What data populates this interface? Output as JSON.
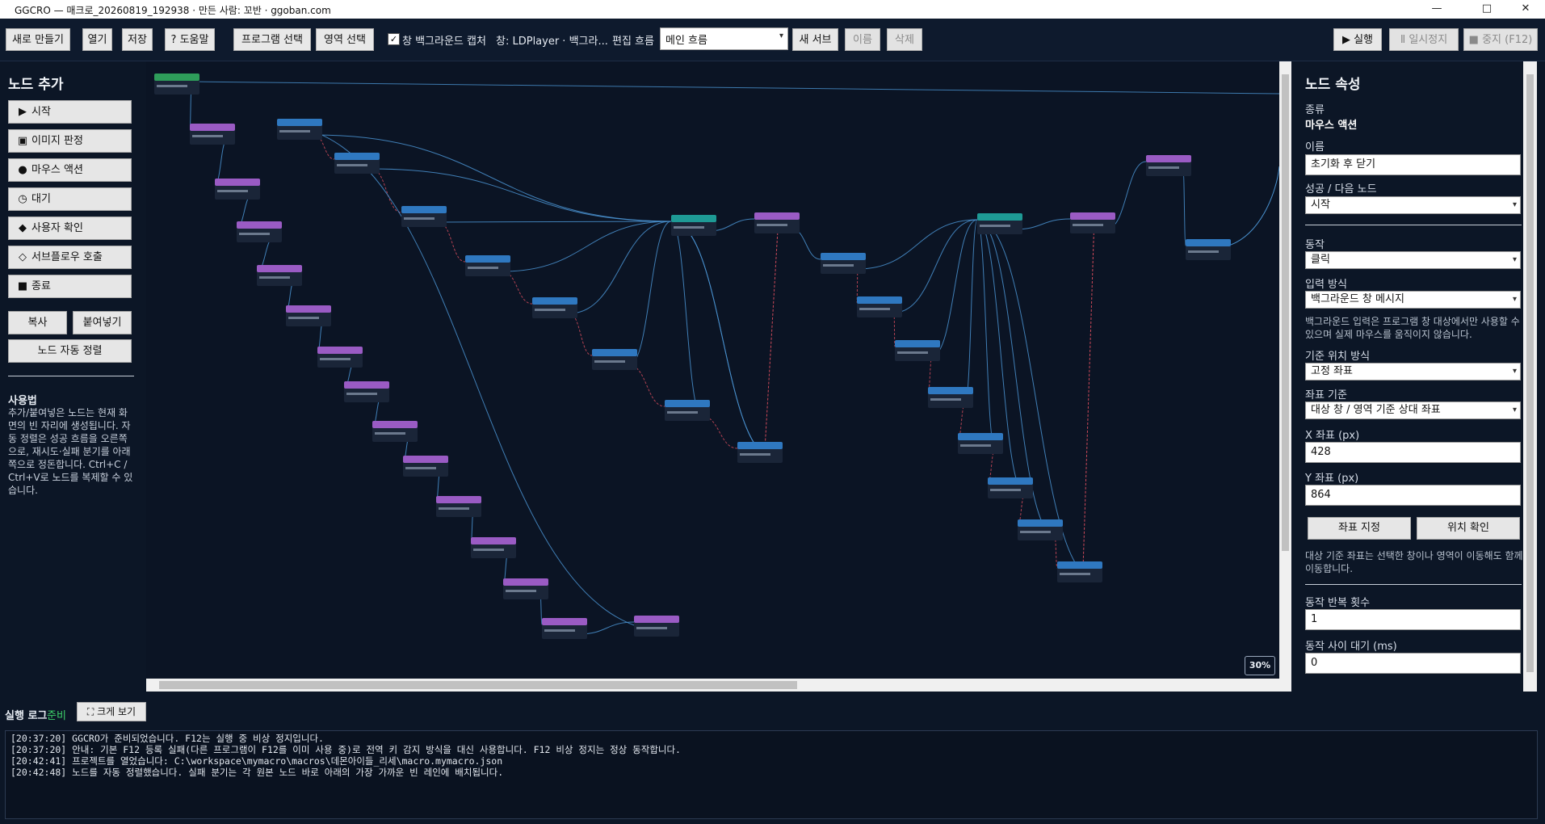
{
  "window": {
    "title": "GGCRO — 매크로_20260819_192938 · 만든 사람: 꼬반 · ggoban.com",
    "minimize": "—",
    "maximize": "□",
    "close": "✕"
  },
  "toolbar": {
    "new_label": "새로 만들기",
    "open_label": "열기",
    "save_label": "저장",
    "help_label": "? 도움말",
    "program_select_label": "프로그램 선택",
    "region_select_label": "영역 선택",
    "bg_capture_label": "창 백그라운드 캡처",
    "bg_capture_checked": true,
    "window_label": "창: LDPlayer · 백그라...",
    "edit_flow_label": "편집 흐름",
    "flow_value": "메인 흐름",
    "new_sub_label": "새 서브",
    "rename_label": "이름",
    "delete_label": "삭제",
    "run_label": "▶ 실행",
    "pause_label": "Ⅱ 일시정지",
    "stop_label": "■ 중지 (F12)"
  },
  "left_panel": {
    "title": "노드 추가",
    "node_buttons": [
      {
        "icon": "▶",
        "icon_name": "play-icon",
        "label": "시작"
      },
      {
        "icon": "▣",
        "icon_name": "image-icon",
        "label": "이미지 판정"
      },
      {
        "icon": "●",
        "icon_name": "mouse-icon",
        "label": "마우스 액션"
      },
      {
        "icon": "◷",
        "icon_name": "clock-icon",
        "label": "대기"
      },
      {
        "icon": "◆",
        "icon_name": "diamond-icon",
        "label": "사용자 확인"
      },
      {
        "icon": "◇",
        "icon_name": "subflow-icon",
        "label": "서브플로우 호출"
      },
      {
        "icon": "■",
        "icon_name": "stop-icon",
        "label": "종료"
      }
    ],
    "copy_label": "복사",
    "paste_label": "붙여넣기",
    "auto_align_label": "노드 자동 정렬",
    "usage_title": "사용법",
    "usage_text": "추가/붙여넣은 노드는 현재 화면의 빈 자리에 생성됩니다. 자동 정렬은 성공 흐름을 오른쪽으로, 재시도·실패 분기를 아래쪽으로 정돈합니다. Ctrl+C / Ctrl+V로 노드를 복제할 수 있습니다."
  },
  "canvas": {
    "zoom": "30%"
  },
  "properties": {
    "title": "노드 속성",
    "type_label": "종류",
    "type_value": "마우스 액션",
    "name_label": "이름",
    "name_value": "초기화 후 닫기",
    "next_label": "성공 / 다음 노드",
    "next_value": "시작",
    "action_label": "동작",
    "action_value": "클릭",
    "input_label": "입력 방식",
    "input_value": "백그라운드 창 메시지",
    "input_note": "백그라운드 입력은 프로그램 창 대상에서만 사용할 수 있으며 실제 마우스를 움직이지 않습니다.",
    "ref_label": "기준 위치 방식",
    "ref_value": "고정 좌표",
    "coord_label": "좌표 기준",
    "coord_value": "대상 창 / 영역 기준 상대 좌표",
    "x_label": "X 좌표 (px)",
    "x_value": "428",
    "y_label": "Y 좌표 (px)",
    "y_value": "864",
    "set_coord_label": "좌표 지정",
    "check_pos_label": "위치 확인",
    "coord_note": "대상 기준 좌표는 선택한 창이나 영역이 이동해도 함께 이동합니다.",
    "repeat_label": "동작 반복 횟수",
    "repeat_value": "1",
    "delay_label": "동작 사이 대기 (ms)",
    "delay_value": "0"
  },
  "log": {
    "title": "실행 로그",
    "status": "준비",
    "expand_label": "⛶ 크게 보기",
    "lines": [
      "[20:37:20] GGCRO가 준비되었습니다. F12는 실행 중 비상 정지입니다.",
      "[20:37:20] 안내: 기본 F12 등록 실패(다른 프로그램이 F12를 이미 사용 중)로 전역 키 감지 방식을 대신 사용합니다. F12 비상 정지는 정상 동작합니다.",
      "[20:42:41] 프로젝트를 열었습니다: C:\\workspace\\mymacro\\macros\\데몬아이들_리세\\macro.mymacro.json",
      "[20:42:48] 노드를 자동 정렬했습니다. 실패 분기는 각 원본 노드 바로 아래의 가장 가까운 빈 레인에 배치됩니다."
    ]
  },
  "colors": {
    "start": "#2e9d5a",
    "image": "#9a5bc4",
    "mouse": "#2f78c0",
    "user": "#1e9a95",
    "edge": "#4a92d0",
    "fail_edge": "#d04a5a"
  }
}
